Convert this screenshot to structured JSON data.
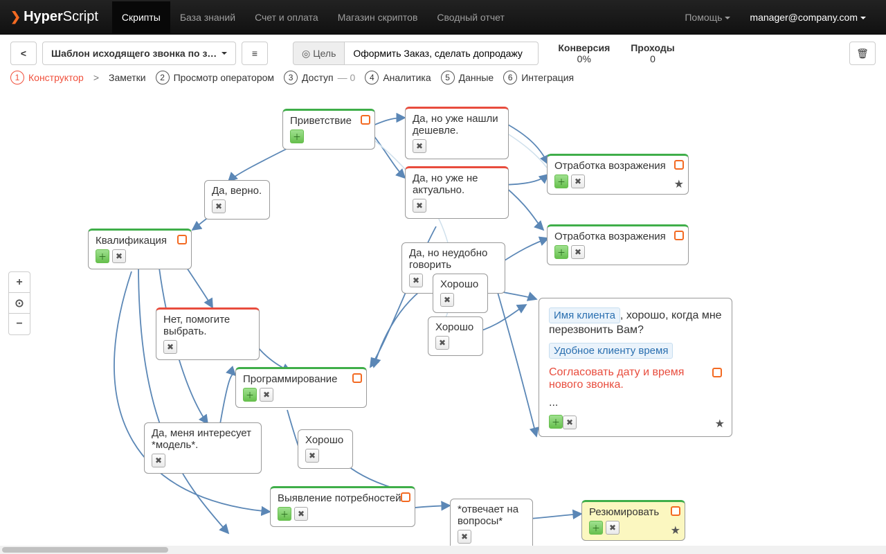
{
  "brand": {
    "bold": "Hyper",
    "light": "Script"
  },
  "nav": {
    "items": [
      "Скрипты",
      "База знаний",
      "Счет и оплата",
      "Магазин скриптов",
      "Сводный отчет"
    ],
    "active": 0,
    "help": "Помощь",
    "user": "manager@company.com"
  },
  "toolbar": {
    "template": "Шаблон исходящего звонка по заяв",
    "goal_label": "Цель",
    "goal_value": "Оформить Заказ, сделать допродажу",
    "stats": {
      "conversion_label": "Конверсия",
      "conversion_value": "0%",
      "passes_label": "Проходы",
      "passes_value": "0"
    }
  },
  "subtabs": {
    "t1": "Конструктор",
    "notes": "Заметки",
    "t2": "Просмотр оператором",
    "t3": "Доступ",
    "t3_extra": "— 0",
    "t4": "Аналитика",
    "t5": "Данные",
    "t6": "Интеграция"
  },
  "nodes": {
    "n1": "Приветствие",
    "n2": "Да, но уже нашли дешевле.",
    "n3": "Да, верно.",
    "n4": "Да, но уже не актуально.",
    "n5": "Отработка возражения",
    "n6": "Квалификация",
    "n7": "Да, но неудобно говорить",
    "n8": "Хорошо",
    "n9": "Отработка возражения",
    "n10": "Нет, помогите выбрать.",
    "n11": "Хорошо",
    "n12": "Программирование",
    "n13": "Хорошо",
    "n14": "Да, меня интересует *модель*.",
    "n15": "Выявление потребностей",
    "n16": "*отвечает на вопросы*",
    "n17": "Резюмировать"
  },
  "detail": {
    "tag1": "Имя клиента",
    "text1": ", хорошо, когда мне перезвонить Вам?",
    "tag2": "Удобное клиенту время",
    "red": "Согласовать дату и время нового звонка.",
    "dots": "..."
  }
}
